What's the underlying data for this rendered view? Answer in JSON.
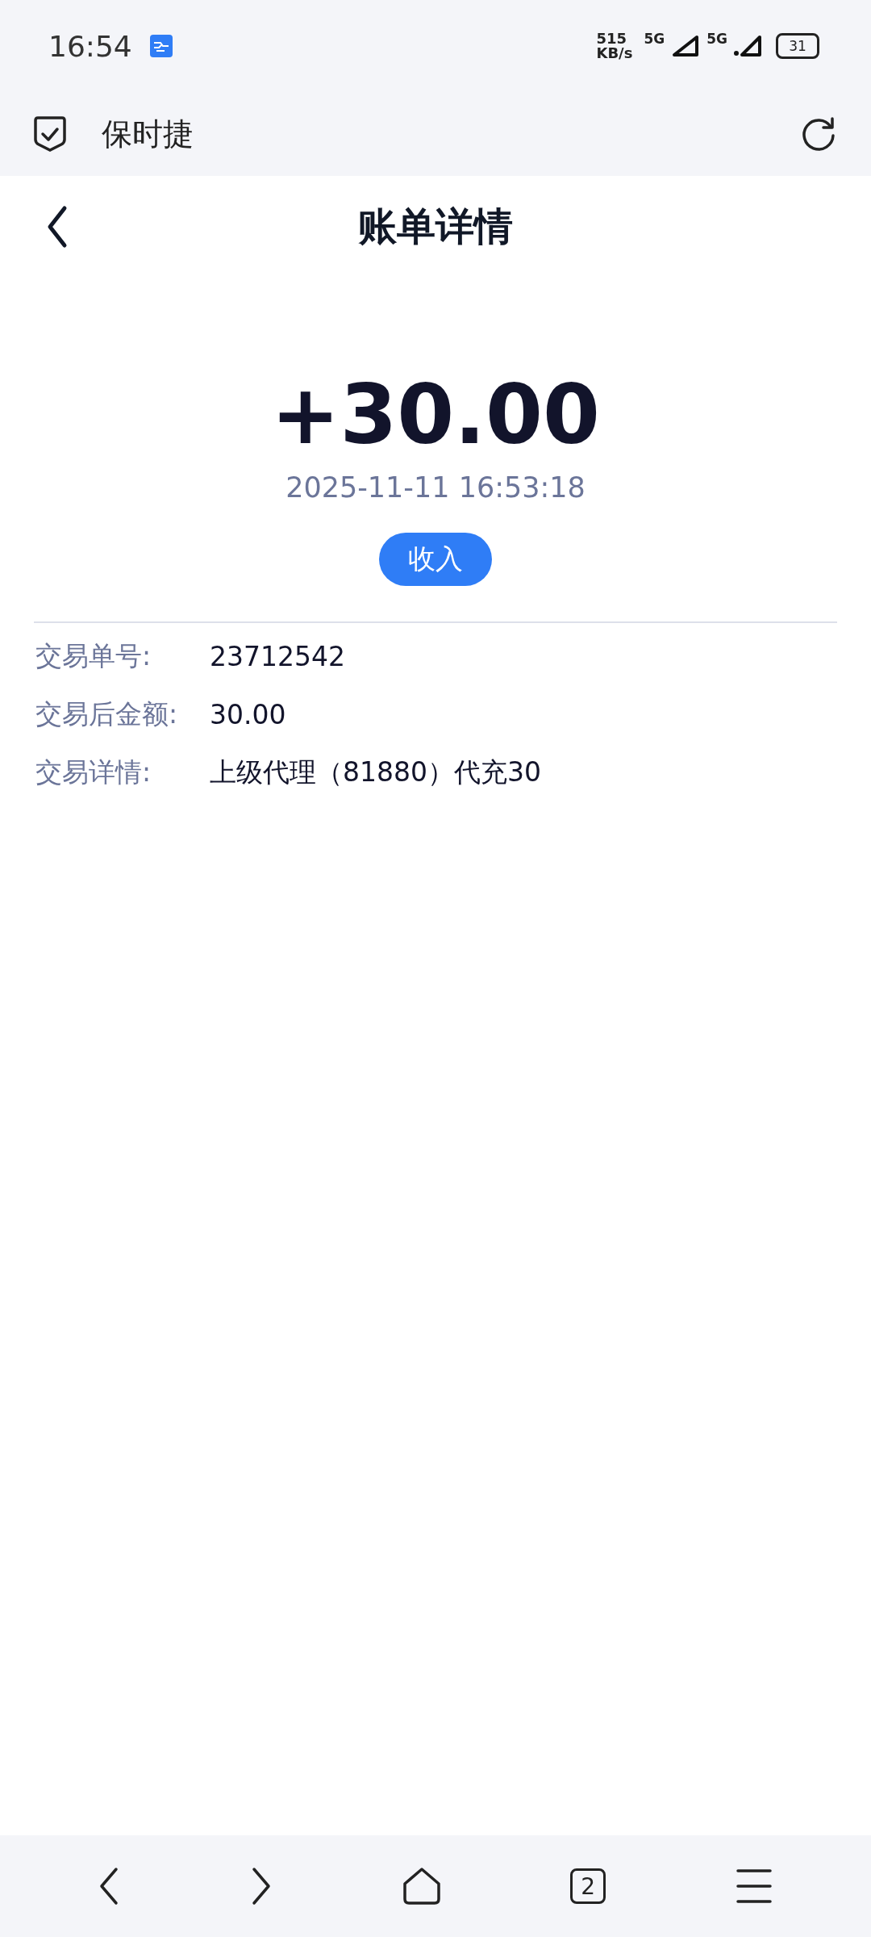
{
  "status_bar": {
    "time": "16:54",
    "speed_value": "515",
    "speed_unit": "KB/s",
    "sim_1": "5G",
    "sim_2": "5G",
    "battery": "31"
  },
  "browser_bar": {
    "title": "保时捷"
  },
  "header": {
    "title": "账单详情"
  },
  "transaction": {
    "amount": "+30.00",
    "time": "2025-11-11 16:53:18",
    "type_badge": "收入"
  },
  "details": [
    {
      "label": "交易单号:",
      "value": "23712542"
    },
    {
      "label": "交易后金额:",
      "value": "30.00"
    },
    {
      "label": "交易详情:",
      "value": "上级代理（81880）代充30"
    }
  ],
  "bottom_nav": {
    "tab_count": "2"
  }
}
